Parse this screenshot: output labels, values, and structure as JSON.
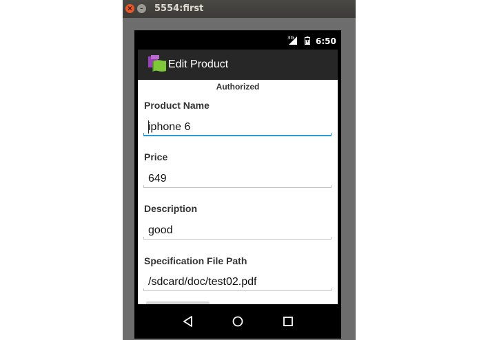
{
  "window": {
    "title": "5554:first",
    "close_glyph": "×",
    "minimize_glyph": "–"
  },
  "status_bar": {
    "network": "3G",
    "time": "6:50",
    "icons": [
      "signal-icon",
      "battery-icon"
    ]
  },
  "action_bar": {
    "title": "Edit Product",
    "icon": "app-icon"
  },
  "form": {
    "status": "Authorized",
    "fields": [
      {
        "label": "Product Name",
        "value": "iphone 6"
      },
      {
        "label": "Price",
        "value": "649"
      },
      {
        "label": "Description",
        "value": "good"
      },
      {
        "label": "Specification File Path",
        "value": "/sdcard/doc/test02.pdf"
      }
    ]
  },
  "nav_bar": {
    "buttons": [
      "back-icon",
      "home-icon",
      "recents-icon"
    ]
  },
  "colors": {
    "focus_accent": "#2b9bd1",
    "action_bar_bg": "#272727",
    "window_close": "#e9572c"
  }
}
